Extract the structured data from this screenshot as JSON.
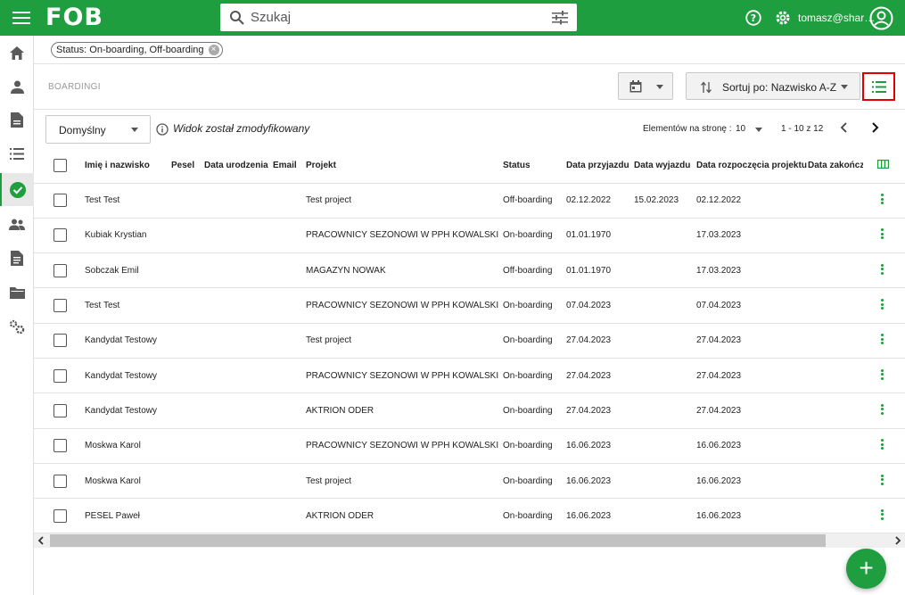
{
  "app": {
    "logo": "FOB",
    "user": "tomasz@shar…"
  },
  "search": {
    "placeholder": "Szukaj"
  },
  "filters": {
    "chip": "Status: On-boarding, Off-boarding"
  },
  "section": {
    "title": "BOARDINGI"
  },
  "toolbar": {
    "sort_label": "Sortuj po: Nazwisko A-Z"
  },
  "controls": {
    "view": "Domyślny",
    "modified": "Widok został zmodyfikowany",
    "per_page_label": "Elementów na stronę :",
    "per_page_value": "10",
    "range": "1 - 10 z 12"
  },
  "table": {
    "columns": [
      "Imię i nazwisko",
      "Pesel",
      "Data urodzenia",
      "Email",
      "Projekt",
      "Status",
      "Data przyjazdu",
      "Data wyjazdu",
      "Data rozpoczęcia projektu",
      "Data zakończ"
    ],
    "rows": [
      {
        "name": "Test Test",
        "pesel": "",
        "birth": "",
        "email": "",
        "project": "Test project",
        "status": "Off-boarding",
        "arrival": "02.12.2022",
        "departure": "15.02.2023",
        "start": "02.12.2022",
        "end": ""
      },
      {
        "name": "Kubiak Krystian",
        "pesel": "",
        "birth": "",
        "email": "",
        "project": "PRACOWNICY SEZONOWI W PPH KOWALSKI",
        "status": "On-boarding",
        "arrival": "01.01.1970",
        "departure": "",
        "start": "17.03.2023",
        "end": ""
      },
      {
        "name": "Sobczak Emil",
        "pesel": "",
        "birth": "",
        "email": "",
        "project": "MAGAZYN NOWAK",
        "status": "Off-boarding",
        "arrival": "01.01.1970",
        "departure": "",
        "start": "17.03.2023",
        "end": ""
      },
      {
        "name": "Test Test",
        "pesel": "",
        "birth": "",
        "email": "",
        "project": "PRACOWNICY SEZONOWI W PPH KOWALSKI",
        "status": "On-boarding",
        "arrival": "07.04.2023",
        "departure": "",
        "start": "07.04.2023",
        "end": ""
      },
      {
        "name": "Kandydat Testowy",
        "pesel": "",
        "birth": "",
        "email": "",
        "project": "Test project",
        "status": "On-boarding",
        "arrival": "27.04.2023",
        "departure": "",
        "start": "27.04.2023",
        "end": ""
      },
      {
        "name": "Kandydat Testowy",
        "pesel": "",
        "birth": "",
        "email": "",
        "project": "PRACOWNICY SEZONOWI W PPH KOWALSKI",
        "status": "On-boarding",
        "arrival": "27.04.2023",
        "departure": "",
        "start": "27.04.2023",
        "end": ""
      },
      {
        "name": "Kandydat Testowy",
        "pesel": "",
        "birth": "",
        "email": "",
        "project": "AKTRION ODER",
        "status": "On-boarding",
        "arrival": "27.04.2023",
        "departure": "",
        "start": "27.04.2023",
        "end": ""
      },
      {
        "name": "Moskwa Karol",
        "pesel": "",
        "birth": "",
        "email": "",
        "project": "PRACOWNICY SEZONOWI W PPH KOWALSKI",
        "status": "On-boarding",
        "arrival": "16.06.2023",
        "departure": "",
        "start": "16.06.2023",
        "end": ""
      },
      {
        "name": "Moskwa Karol",
        "pesel": "",
        "birth": "",
        "email": "",
        "project": "Test project",
        "status": "On-boarding",
        "arrival": "16.06.2023",
        "departure": "",
        "start": "16.06.2023",
        "end": ""
      },
      {
        "name": "PESEL Paweł",
        "pesel": "",
        "birth": "",
        "email": "",
        "project": "AKTRION ODER",
        "status": "On-boarding",
        "arrival": "16.06.2023",
        "departure": "",
        "start": "16.06.2023",
        "end": ""
      }
    ]
  },
  "icons": {
    "sidebar": [
      "home-icon",
      "person-icon",
      "document-icon",
      "list-icon",
      "check-circle-icon",
      "group-icon",
      "file-icon",
      "folder-icon",
      "settings-icon"
    ],
    "accent": "#1e9e3e"
  }
}
